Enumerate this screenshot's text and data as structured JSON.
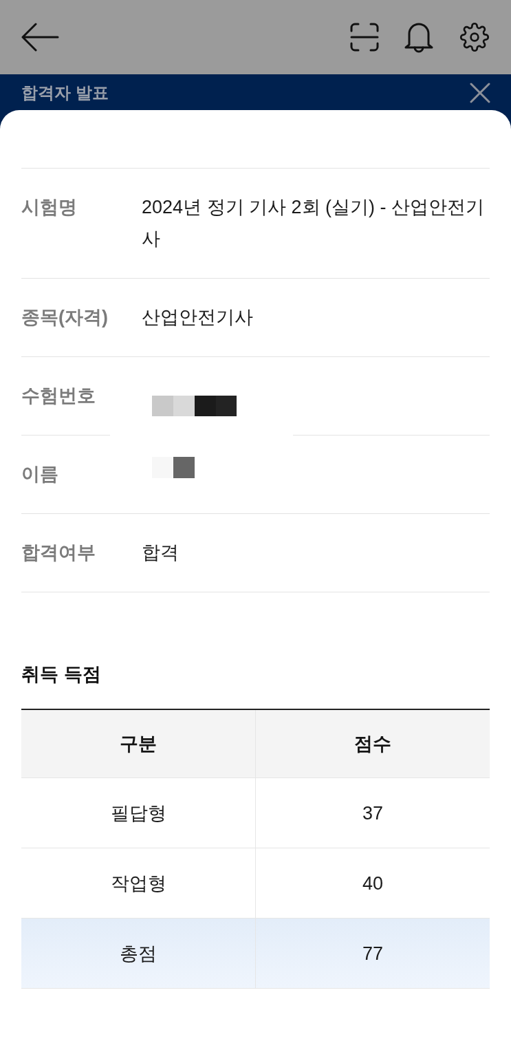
{
  "banner": {
    "title": "합격자 발표"
  },
  "details": [
    {
      "label": "시험명",
      "value": "2024년 정기 기사 2회 (실기) - 산업안전기사",
      "redacted": false
    },
    {
      "label": "종목(자격)",
      "value": "산업안전기사",
      "redacted": false
    },
    {
      "label": "수험번호",
      "redacted": true
    },
    {
      "label": "이름",
      "redacted": true
    },
    {
      "label": "합격여부",
      "value": "합격",
      "redacted": false
    }
  ],
  "score_section": {
    "title": "취득 득점",
    "table": {
      "columns": [
        "구분",
        "점수"
      ],
      "rows": [
        {
          "cells": [
            "필답형",
            "37"
          ],
          "highlighted": false
        },
        {
          "cells": [
            "작업형",
            "40"
          ],
          "highlighted": false
        },
        {
          "cells": [
            "총점",
            "77"
          ],
          "highlighted": true
        }
      ]
    }
  }
}
